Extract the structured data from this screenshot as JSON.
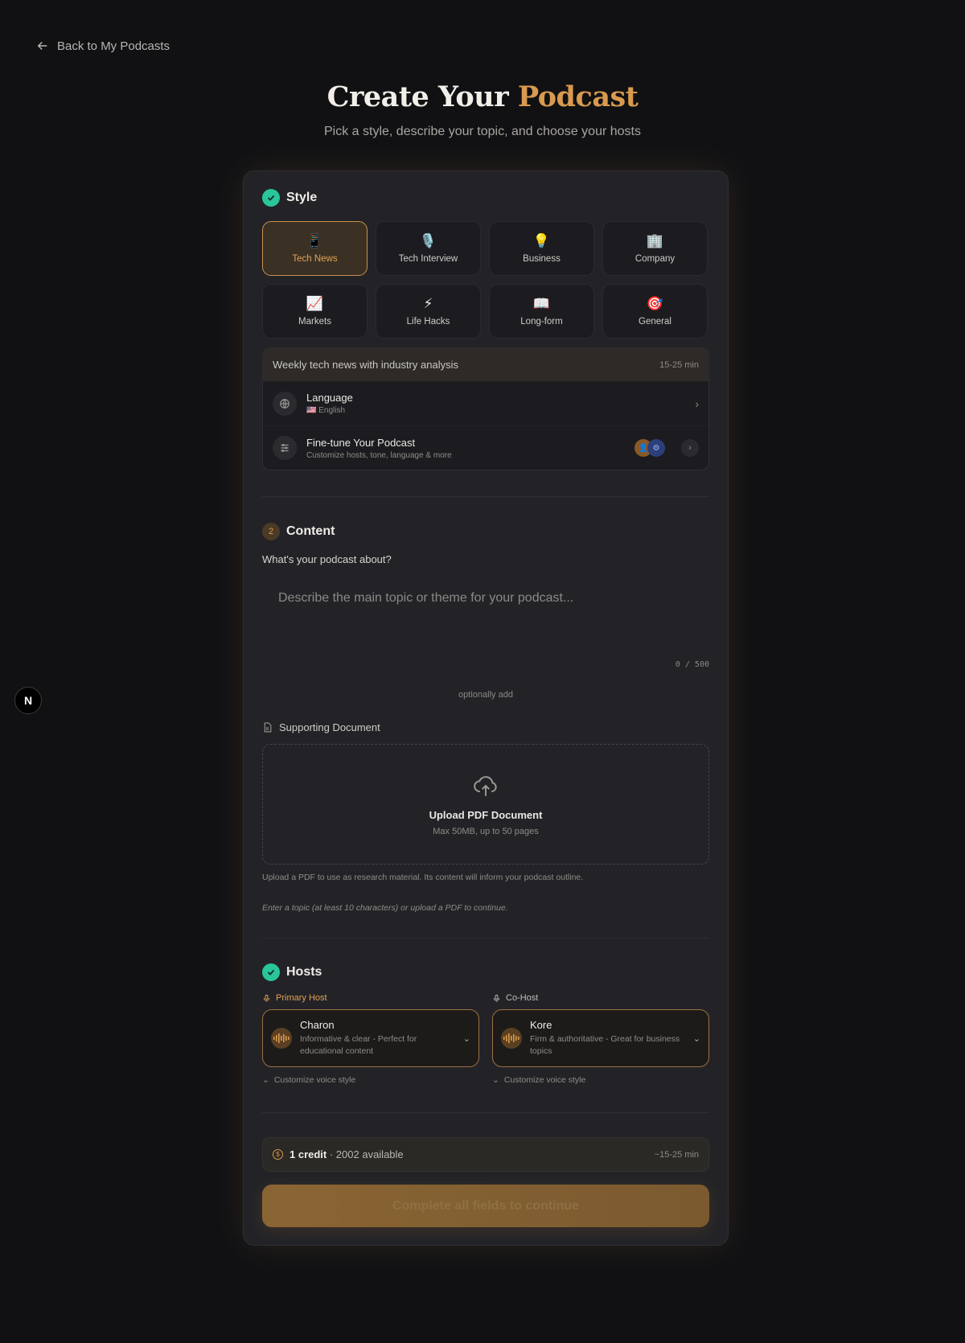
{
  "nav": {
    "back_label": "Back to My Podcasts"
  },
  "hero": {
    "title_prefix": "Create Your",
    "title_accent": "Podcast",
    "subtitle": "Pick a style, describe your topic, and choose your hosts"
  },
  "style": {
    "title": "Style",
    "options": [
      {
        "label": "Tech News",
        "icon": "📱",
        "selected": true
      },
      {
        "label": "Tech Interview",
        "icon": "🎙️"
      },
      {
        "label": "Business",
        "icon": "💡"
      },
      {
        "label": "Company",
        "icon": "🏢"
      },
      {
        "label": "Markets",
        "icon": "📈"
      },
      {
        "label": "Life Hacks",
        "icon": "⚡"
      },
      {
        "label": "Long-form",
        "icon": "📖"
      },
      {
        "label": "General",
        "icon": "🎯"
      }
    ],
    "description": "Weekly tech news with industry analysis",
    "duration": "15-25 min",
    "language": {
      "title": "Language",
      "value": "🇺🇸 English"
    },
    "finetune": {
      "title": "Fine-tune Your Podcast",
      "subtitle": "Customize hosts, tone, language & more"
    }
  },
  "content": {
    "step": "2",
    "title": "Content",
    "question": "What's your podcast about?",
    "placeholder": "Describe the main topic or theme for your podcast...",
    "counter": "0 / 500",
    "optionally_add": "optionally add",
    "doc_label": "Supporting Document",
    "upload_title": "Upload PDF Document",
    "upload_sub": "Max 50MB, up to 50 pages",
    "help": "Upload a PDF to use as research material. Its content will inform your podcast outline.",
    "hint": "Enter a topic (at least 10 characters) or upload a PDF to continue."
  },
  "hosts": {
    "title": "Hosts",
    "primary": {
      "role": "Primary Host",
      "name": "Charon",
      "desc": "Informative & clear - Perfect for educational content"
    },
    "cohost": {
      "role": "Co-Host",
      "name": "Kore",
      "desc": "Firm & authoritative - Great for business topics"
    },
    "customize_label": "Customize voice style"
  },
  "footer": {
    "credit_bold": "1 credit",
    "credit_rest": " · 2002 available",
    "time": "~15-25 min",
    "submit_label": "Complete all fields to continue"
  },
  "colors": {
    "accent": "#d99a4e",
    "success": "#2ac59a",
    "background": "#111114",
    "card": "#232327"
  },
  "dev_badge": "N"
}
